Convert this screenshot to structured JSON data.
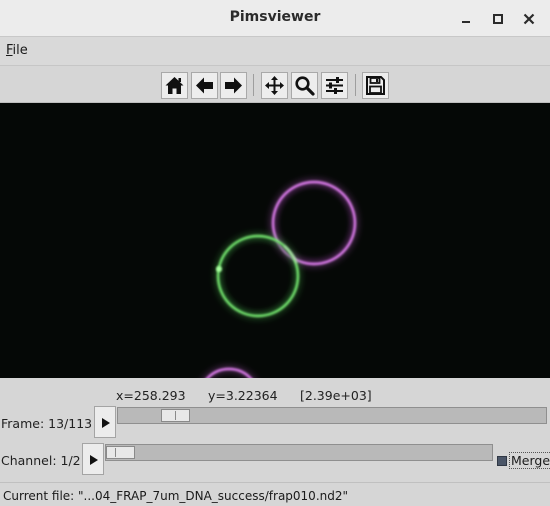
{
  "window": {
    "title": "Pimsviewer"
  },
  "menu": {
    "file_underline": "F",
    "file_rest": "ile"
  },
  "toolbar": {
    "buttons": [
      "home-icon",
      "back-arrow-icon",
      "forward-arrow-icon",
      "pan-icon",
      "zoom-icon",
      "configure-subplots-icon",
      "save-icon"
    ]
  },
  "readout": {
    "x": "x=258.293",
    "y": "y=3.22364",
    "value": "[2.39e+03]"
  },
  "frame": {
    "label": "Frame:",
    "value": "13/113",
    "position": 0.107
  },
  "channel": {
    "label": "Channel:",
    "value": "1/2",
    "position": 0.0
  },
  "merge": {
    "label": "Merge",
    "checked": true
  },
  "status": {
    "text": "Current file: \"...04_FRAP_7um_DNA_success/frap010.nd2\""
  },
  "colors": {
    "green_channel": "#6fe26a",
    "magenta_channel": "#e176ee",
    "background": "#050806"
  }
}
